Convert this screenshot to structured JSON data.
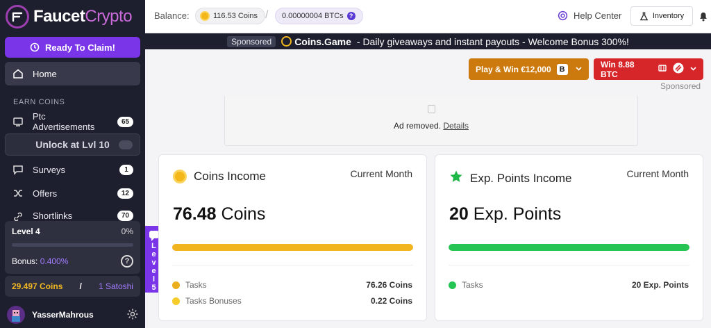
{
  "app": {
    "logo_word": "Faucet",
    "logo_word2": "Crypto"
  },
  "sidebar": {
    "claim_label": "Ready To Claim!",
    "home_label": "Home",
    "section_label": "EARN COINS",
    "items": [
      {
        "label": "Ptc Advertisements",
        "badge": "65",
        "icon": "tv-icon"
      },
      {
        "label": "Surveys",
        "badge": "1",
        "icon": "chat-icon"
      },
      {
        "label": "Offers",
        "badge": "12",
        "icon": "shuffle-icon"
      },
      {
        "label": "Shortlinks",
        "badge": "70",
        "icon": "link-icon"
      }
    ],
    "locked_label": "Unlock at Lvl 10",
    "level": {
      "label": "Level 4",
      "percent": "0%",
      "progress": 0.0,
      "bonus_label": "Bonus:",
      "bonus_value": "0.400%"
    },
    "balance": {
      "coins": "29.497 Coins",
      "separator": "/",
      "satoshi": "1 Satoshi"
    },
    "user": {
      "name": "YasserMahrous"
    }
  },
  "level_tab": {
    "letters": [
      "L",
      "e",
      "v",
      "e",
      "l"
    ],
    "number": "5"
  },
  "header": {
    "balance_label": "Balance:",
    "coins_balance": "116.53 Coins",
    "slash": "/",
    "btc_balance": "0.00000004 BTCs",
    "btc_help": "?",
    "help_center": "Help Center",
    "inventory": "Inventory"
  },
  "sponsor_bar": {
    "tag": "Sponsored",
    "brand": "Coins.Game",
    "text": "- Daily giveaways and instant payouts - Welcome Bonus 300%!"
  },
  "promos": {
    "play": "Play & Win €12,000",
    "play_badge": "B",
    "win": "Win 8.88 BTC",
    "sponsored": "Sponsored"
  },
  "ad": {
    "text": "Ad removed.",
    "link": "Details"
  },
  "cards": {
    "coins": {
      "title": "Coins Income",
      "period": "Current Month",
      "amount": "76.48",
      "unit": "Coins",
      "progress": 1.0,
      "rows": [
        {
          "label": "Tasks",
          "value": "76.26 Coins"
        },
        {
          "label": "Tasks Bonuses",
          "value": "0.22 Coins"
        }
      ]
    },
    "exp": {
      "title": "Exp. Points Income",
      "period": "Current Month",
      "amount": "20",
      "unit": "Exp. Points",
      "progress": 1.0,
      "rows": [
        {
          "label": "Tasks",
          "value": "20 Exp. Points"
        }
      ]
    }
  },
  "colors": {
    "accent": "#7b35e8",
    "sidebar_bg": "#1e1f2e",
    "coins_bar": "#f0b51f",
    "exp_bar": "#26c453",
    "play_btn": "#cc7a0e",
    "win_btn": "#d6262a"
  }
}
